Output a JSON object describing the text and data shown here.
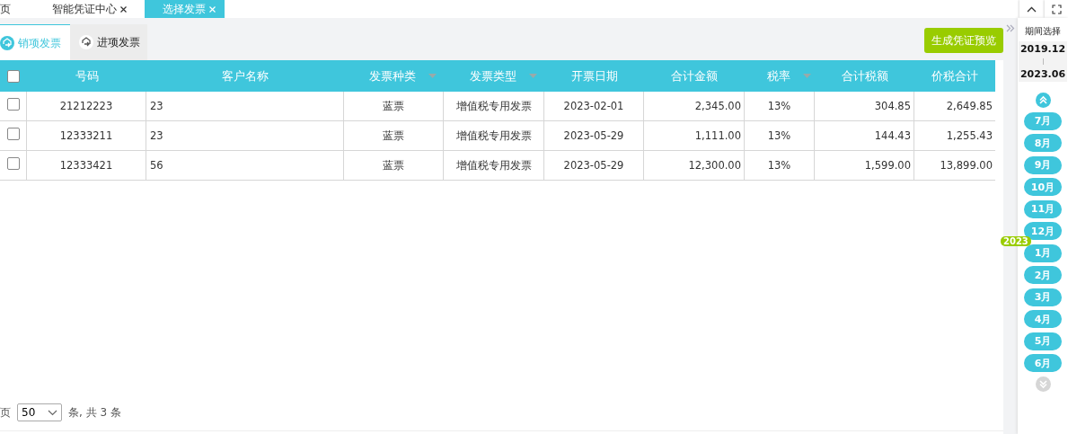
{
  "top_tabs": [
    {
      "label": "页",
      "selected": false,
      "closable": false
    },
    {
      "label": "智能凭证中心",
      "selected": false,
      "closable": true
    },
    {
      "label": "选择发票",
      "selected": true,
      "closable": true
    }
  ],
  "sub_tabs": [
    {
      "label": "销项发票",
      "selected": true
    },
    {
      "label": "进项发票",
      "selected": false
    }
  ],
  "preview_button": "生成凭证预览",
  "table": {
    "select_all_checked": false,
    "columns": [
      {
        "label": "号码",
        "sortable": false
      },
      {
        "label": "客户名称",
        "sortable": false
      },
      {
        "label": "发票种类",
        "sortable": true
      },
      {
        "label": "发票类型",
        "sortable": true
      },
      {
        "label": "开票日期",
        "sortable": false
      },
      {
        "label": "合计金额",
        "sortable": false
      },
      {
        "label": "税率",
        "sortable": true
      },
      {
        "label": "合计税额",
        "sortable": false
      },
      {
        "label": "价税合计",
        "sortable": false
      }
    ],
    "rows": [
      {
        "checked": false,
        "cells": [
          "21212223",
          "23",
          "蓝票",
          "增值税专用发票",
          "2023-02-01",
          "2,345.00",
          "13%",
          "304.85",
          "2,649.85"
        ]
      },
      {
        "checked": false,
        "cells": [
          "12333211",
          "23",
          "蓝票",
          "增值税专用发票",
          "2023-05-29",
          "1,111.00",
          "13%",
          "144.43",
          "1,255.43"
        ]
      },
      {
        "checked": false,
        "cells": [
          "12333421",
          "56",
          "蓝票",
          "增值税专用发票",
          "2023-05-29",
          "12,300.00",
          "13%",
          "1,599.00",
          "13,899.00"
        ]
      }
    ]
  },
  "pagination": {
    "prefix": "页",
    "page_size": "50",
    "suffix": "条, 共 3 条"
  },
  "period": {
    "title": "期间选择",
    "start": "2019.12",
    "end": "2023.06"
  },
  "months": [
    {
      "label": "7月"
    },
    {
      "label": "8月"
    },
    {
      "label": "9月"
    },
    {
      "label": "10月"
    },
    {
      "label": "11月"
    },
    {
      "label": "12月"
    },
    {
      "label": "1月",
      "year": "2023"
    },
    {
      "label": "2月"
    },
    {
      "label": "3月"
    },
    {
      "label": "4月"
    },
    {
      "label": "5月"
    },
    {
      "label": "6月"
    }
  ]
}
